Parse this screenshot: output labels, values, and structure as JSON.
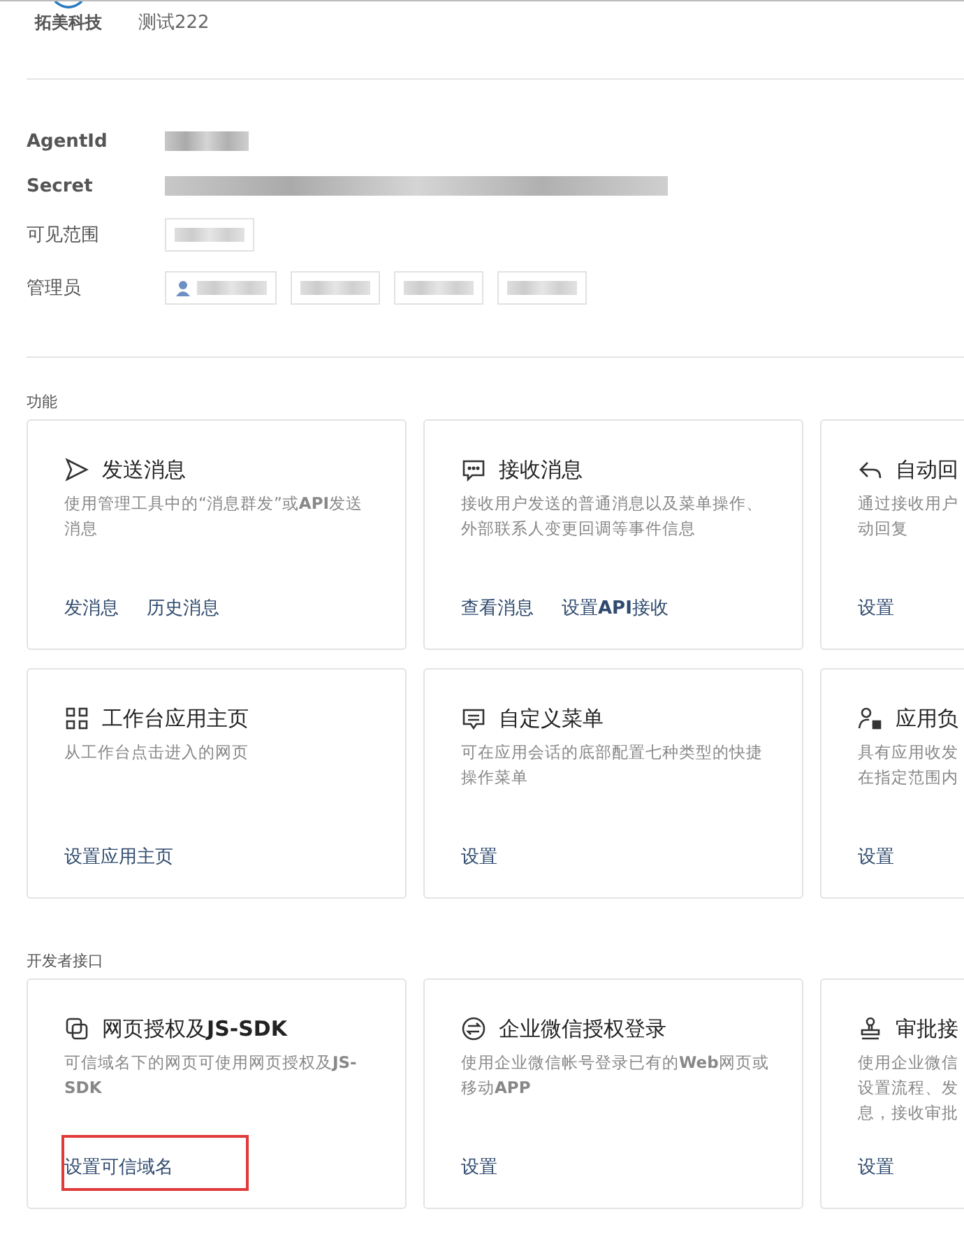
{
  "header": {
    "logo_text": "拓美科技",
    "app_name": "测试222"
  },
  "fields": [
    {
      "label": "AgentId",
      "kind": "bold"
    },
    {
      "label": "Secret",
      "kind": "bold"
    },
    {
      "label": "可见范围",
      "kind": "plain"
    },
    {
      "label": "管理员",
      "kind": "plain"
    }
  ],
  "sections": [
    {
      "title": "功能",
      "cards": [
        {
          "title": "发送消息",
          "desc_lines": [
            "使用管理工具中的“消息群发”或**API**发送",
            "消息"
          ],
          "links": [
            {
              "text": "发消息",
              "highlighted": false
            },
            {
              "text": "历史消息",
              "highlighted": false
            }
          ]
        },
        {
          "title": "接收消息",
          "desc_lines": [
            "接收用户发送的普通消息以及菜单操作、",
            "外部联系人变更回调等事件信息"
          ],
          "links": [
            {
              "text": "查看消息",
              "highlighted": false
            },
            {
              "text": "设置**API**接收",
              "highlighted": false
            }
          ]
        },
        {
          "title": "自动回",
          "desc_lines": [
            "通过接收用户",
            "动回复"
          ],
          "links": [
            {
              "text": "设置",
              "highlighted": false
            }
          ]
        }
      ]
    },
    {
      "cards": [
        {
          "title": "工作台应用主页",
          "desc_lines": [
            "从工作台点击进入的网页"
          ],
          "links": [
            {
              "text": "设置应用主页",
              "highlighted": false
            }
          ]
        },
        {
          "title": "自定义菜单",
          "desc_lines": [
            "可在应用会话的底部配置七种类型的快捷",
            "操作菜单"
          ],
          "links": [
            {
              "text": "设置",
              "highlighted": false
            }
          ]
        },
        {
          "title": "应用负",
          "desc_lines": [
            "具有应用收发",
            "在指定范围内"
          ],
          "links": [
            {
              "text": "设置",
              "highlighted": false
            }
          ]
        }
      ]
    },
    {
      "title": "开发者接口",
      "cards": [
        {
          "title": "网页授权及**JS-SDK**",
          "desc_lines": [
            "可信域名下的网页可使用网页授权及**JS-**",
            "**SDK**"
          ],
          "links": [
            {
              "text": "设置可信域名",
              "highlighted": true
            }
          ]
        },
        {
          "title": "企业微信授权登录",
          "desc_lines": [
            "使用企业微信帐号登录已有的**Web**网页或",
            "移动**APP**"
          ],
          "links": [
            {
              "text": "设置",
              "highlighted": false
            }
          ]
        },
        {
          "title": "审批接",
          "desc_lines": [
            "使用企业微信",
            "设置流程、发",
            "息，接收审批"
          ],
          "links": [
            {
              "text": "设置",
              "highlighted": false
            }
          ]
        }
      ]
    }
  ]
}
